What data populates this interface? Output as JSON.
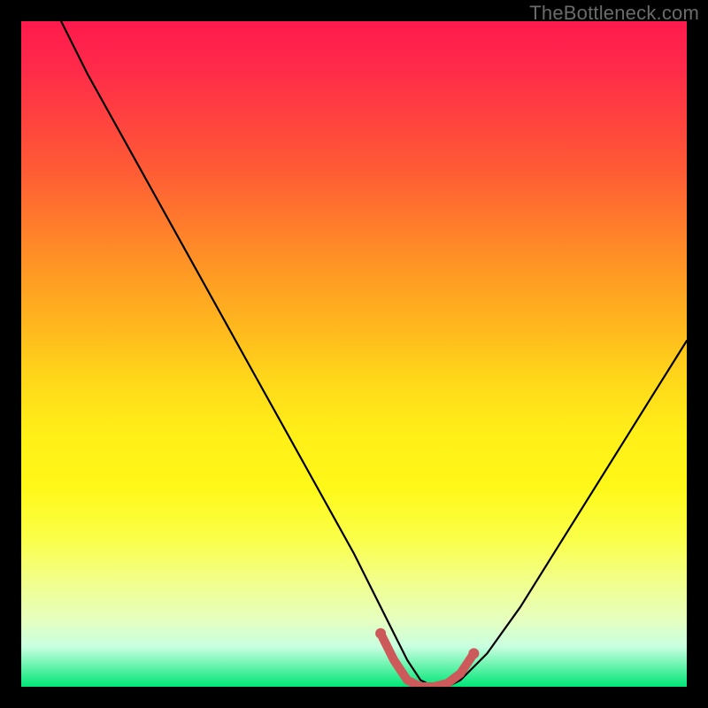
{
  "watermark": "TheBottleneck.com",
  "chart_data": {
    "type": "line",
    "title": "",
    "xlabel": "",
    "ylabel": "",
    "xlim": [
      0,
      100
    ],
    "ylim": [
      0,
      100
    ],
    "series": [
      {
        "name": "bottleneck-curve",
        "x": [
          6,
          10,
          15,
          20,
          25,
          30,
          35,
          40,
          45,
          50,
          54,
          56,
          58,
          60,
          62,
          64,
          66,
          70,
          75,
          80,
          85,
          90,
          95,
          100
        ],
        "y": [
          100,
          92,
          83,
          74,
          65,
          56,
          47,
          38,
          29,
          20,
          12,
          8,
          4,
          1,
          0,
          0,
          1,
          5,
          12,
          20,
          28,
          36,
          44,
          52
        ]
      }
    ],
    "highlight_segment": {
      "name": "bottleneck-minimum",
      "color": "#cc5a5a",
      "x": [
        54,
        56,
        58,
        60,
        62,
        64,
        66,
        68
      ],
      "y": [
        8,
        4,
        1,
        0,
        0,
        0.5,
        2,
        5
      ]
    },
    "gradient_stops": [
      {
        "pos": 0.0,
        "color": "#ff1a4d"
      },
      {
        "pos": 0.5,
        "color": "#ffd81a"
      },
      {
        "pos": 0.9,
        "color": "#e6ffc0"
      },
      {
        "pos": 1.0,
        "color": "#00e676"
      }
    ]
  }
}
